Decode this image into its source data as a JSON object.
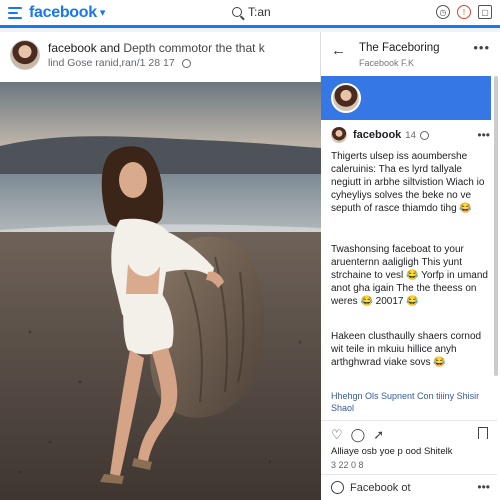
{
  "topbar": {
    "logo": "facebook",
    "logo_caret": "▾",
    "search_text": "T:an"
  },
  "post": {
    "title_name": "facebook and",
    "title_rest": "Depth commotor the that k",
    "subtitle": "lind Gose ranid,ran/1 28 17"
  },
  "panel": {
    "back": "←",
    "title": "The Faceboring",
    "subtitle": "Facebook F.K",
    "menu": "•••",
    "comment": {
      "name": "facebook",
      "time": "14",
      "menu": "•••",
      "para1": "Thigerts ulsep iss aoumbershe caleruinis: Tha es lyrd tallyale negiutt in arbhe siltvistion Wiach io cyheyliys solves the beke no ve seputh of rasce thiamdo tihg 😂",
      "para2": "Twashonsing faceboat to your aruenternn aaligligh This yunt strchaine to vesl 😂 Yorfp in umand anot gha igain The the theess on weres 😂 20017 😂",
      "para3": "Hakeen clusthaully shaers cornod wit teile in mkuiu hillice anyh arthghwrad viake sovs 😂",
      "tags": "Hhehgn Ols Supnent Con tiiiny Shisir Shaol",
      "likes": "Alliaye osb yoe p ood Shitelk",
      "likes_time": "3 22 0 8"
    },
    "composer": "Facebook ot",
    "composer_menu": "•••"
  }
}
